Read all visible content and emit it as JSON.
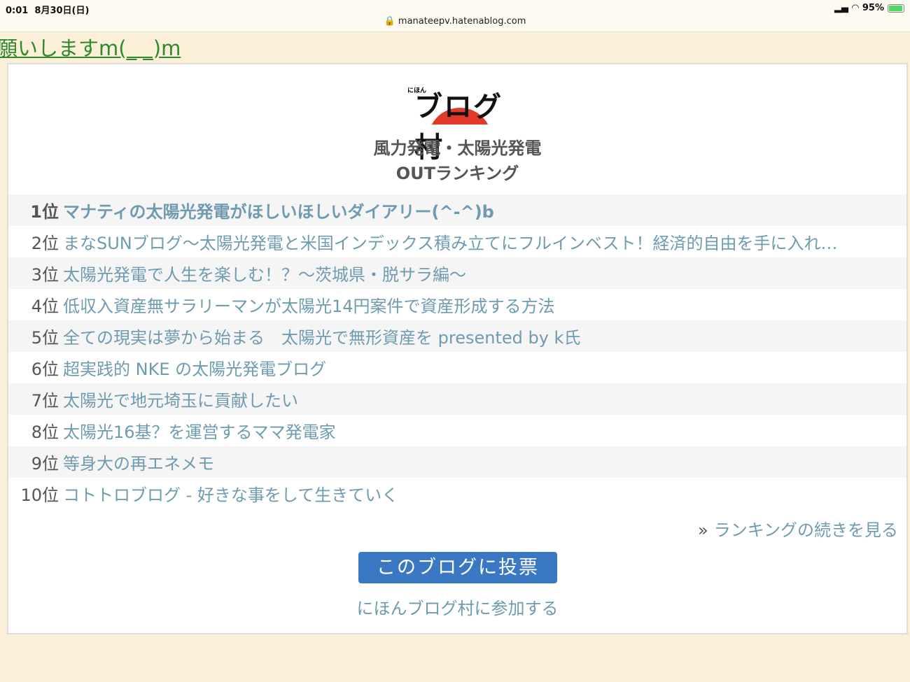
{
  "status": {
    "time": "0:01",
    "date": "8月30日(日)",
    "url": "manateepv.hatenablog.com",
    "battery": "95%",
    "battery_level": 0.95
  },
  "banner": {
    "text": "願いしますm(_ _)m"
  },
  "widget": {
    "logo_small": "にほん",
    "logo_text": "ブログ村",
    "category_line1": "風力発電・太陽光発電",
    "category_line2": "OUTランキング",
    "rankings": [
      {
        "rank": "1位",
        "title": "マナティの太陽光発電がほしいほしいダイアリー(^-^)b"
      },
      {
        "rank": "2位",
        "title": "まなSUNブログ〜太陽光発電と米国インデックス積み立てにフルインベスト！経済的自由を手に入れ…"
      },
      {
        "rank": "3位",
        "title": "太陽光発電で人生を楽しむ！？〜茨城県・脱サラ編〜"
      },
      {
        "rank": "4位",
        "title": "低収入資産無サラリーマンが太陽光14円案件で資産形成する方法"
      },
      {
        "rank": "5位",
        "title": "全ての現実は夢から始まる　太陽光で無形資産を presented by k氏"
      },
      {
        "rank": "6位",
        "title": "超実践的 NKE の太陽光発電ブログ"
      },
      {
        "rank": "7位",
        "title": "太陽光で地元埼玉に貢献したい"
      },
      {
        "rank": "8位",
        "title": "太陽光16基？を運営するママ発電家"
      },
      {
        "rank": "9位",
        "title": "等身大の再エネメモ"
      },
      {
        "rank": "10位",
        "title": "コトトロブログ - 好きな事をして生きていく"
      }
    ],
    "more_icon": "»",
    "more_label": "ランキングの続きを見る",
    "vote_label": "このブログに投票",
    "join_label": "にほんブログ村に参加する"
  }
}
